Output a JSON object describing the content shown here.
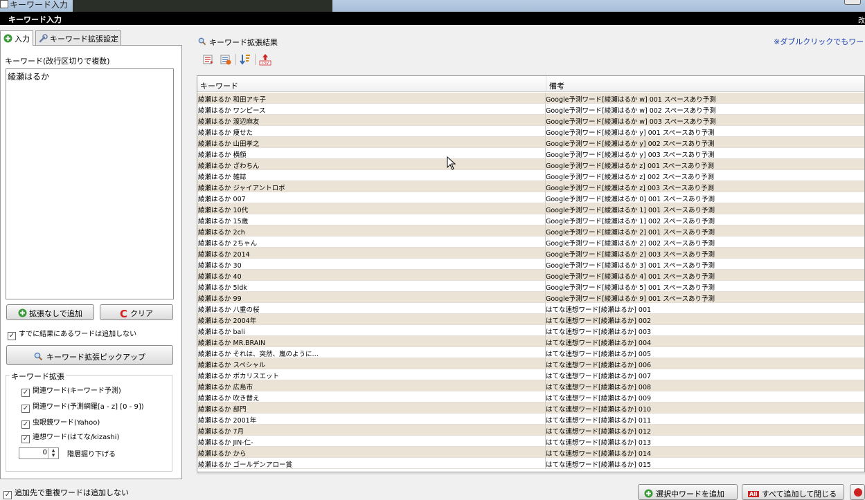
{
  "outer_window": {
    "title": "キーワード入力"
  },
  "window": {
    "title": "キーワード入力",
    "right_fragment": "改"
  },
  "tabs": [
    {
      "label": "入力",
      "icon": "plus-circle-icon",
      "active": true
    },
    {
      "label": "キーワード拡張設定",
      "icon": "wrench-icon",
      "active": false
    }
  ],
  "input_panel": {
    "keyword_label": "キーワード(改行区切りで複数)",
    "keyword_value": "綾瀬はるか",
    "add_no_expand_label": "拡張なしで追加",
    "clear_label": "クリア",
    "skip_existing_label": "すでに結果にあるワードは追加しない",
    "skip_existing_checked": true,
    "pickup_label": "キーワード拡張ピックアップ",
    "expand_group_title": "キーワード拡張",
    "options": [
      {
        "label": "関連ワード(キーワード予測)",
        "checked": true
      },
      {
        "label": "関連ワード(予測網羅[a - z] [0 - 9])",
        "checked": true
      },
      {
        "label": "虫眼鏡ワード(Yahoo)",
        "checked": true
      },
      {
        "label": "連想ワード(はてな/kizashi)",
        "checked": true
      }
    ],
    "depth_value": "0",
    "depth_label": "階層掘り下げる"
  },
  "bottom": {
    "no_duplicate_label": "追加先で重複ワードは追加しない",
    "no_duplicate_checked": true,
    "add_selected_label": "選択中ワードを追加",
    "add_all_close_label": "すべて追加して閉じる"
  },
  "results": {
    "title": "キーワード拡張結果",
    "note": "※ダブルクリックでもワード追",
    "columns": [
      "キーワード",
      "備考"
    ],
    "rows": [
      [
        "綾瀬はるか 和田アキ子",
        "Google予測ワード[綾瀬はるか w] 001 スペースあり予測"
      ],
      [
        "綾瀬はるか ワンピース",
        "Google予測ワード[綾瀬はるか w] 002 スペースあり予測"
      ],
      [
        "綾瀬はるか 渡辺麻友",
        "Google予測ワード[綾瀬はるか w] 003 スペースあり予測"
      ],
      [
        "綾瀬はるか 痩せた",
        "Google予測ワード[綾瀬はるか y] 001 スペースあり予測"
      ],
      [
        "綾瀬はるか 山田孝之",
        "Google予測ワード[綾瀬はるか y] 002 スペースあり予測"
      ],
      [
        "綾瀬はるか 横顔",
        "Google予測ワード[綾瀬はるか y] 003 スペースあり予測"
      ],
      [
        "綾瀬はるか ざわちん",
        "Google予測ワード[綾瀬はるか z] 001 スペースあり予測"
      ],
      [
        "綾瀬はるか 雑誌",
        "Google予測ワード[綾瀬はるか z] 002 スペースあり予測"
      ],
      [
        "綾瀬はるか ジャイアントロボ",
        "Google予測ワード[綾瀬はるか z] 003 スペースあり予測"
      ],
      [
        "綾瀬はるか 007",
        "Google予測ワード[綾瀬はるか 0] 001 スペースあり予測"
      ],
      [
        "綾瀬はるか 10代",
        "Google予測ワード[綾瀬はるか 1] 001 スペースあり予測"
      ],
      [
        "綾瀬はるか 15歳",
        "Google予測ワード[綾瀬はるか 1] 002 スペースあり予測"
      ],
      [
        "綾瀬はるか 2ch",
        "Google予測ワード[綾瀬はるか 2] 001 スペースあり予測"
      ],
      [
        "綾瀬はるか 2ちゃん",
        "Google予測ワード[綾瀬はるか 2] 002 スペースあり予測"
      ],
      [
        "綾瀬はるか 2014",
        "Google予測ワード[綾瀬はるか 2] 003 スペースあり予測"
      ],
      [
        "綾瀬はるか 30",
        "Google予測ワード[綾瀬はるか 3] 001 スペースあり予測"
      ],
      [
        "綾瀬はるか 40",
        "Google予測ワード[綾瀬はるか 4] 001 スペースあり予測"
      ],
      [
        "綾瀬はるか 5ldk",
        "Google予測ワード[綾瀬はるか 5] 001 スペースあり予測"
      ],
      [
        "綾瀬はるか 99",
        "Google予測ワード[綾瀬はるか 9] 001 スペースあり予測"
      ],
      [
        "綾瀬はるか 八重の桜",
        "はてな連想ワード[綾瀬はるか] 001"
      ],
      [
        "綾瀬はるか 2004年",
        "はてな連想ワード[綾瀬はるか] 002"
      ],
      [
        "綾瀬はるか bali",
        "はてな連想ワード[綾瀬はるか] 003"
      ],
      [
        "綾瀬はるか MR.BRAIN",
        "はてな連想ワード[綾瀬はるか] 004"
      ],
      [
        "綾瀬はるか それは、突然、嵐のように…",
        "はてな連想ワード[綾瀬はるか] 005"
      ],
      [
        "綾瀬はるか スペシャル",
        "はてな連想ワード[綾瀬はるか] 006"
      ],
      [
        "綾瀬はるか ポカリスエット",
        "はてな連想ワード[綾瀬はるか] 007"
      ],
      [
        "綾瀬はるか 広島市",
        "はてな連想ワード[綾瀬はるか] 008"
      ],
      [
        "綾瀬はるか 吹き替え",
        "はてな連想ワード[綾瀬はるか] 009"
      ],
      [
        "綾瀬はるか 部門",
        "はてな連想ワード[綾瀬はるか] 010"
      ],
      [
        "綾瀬はるか 2001年",
        "はてな連想ワード[綾瀬はるか] 011"
      ],
      [
        "綾瀬はるか 7月",
        "はてな連想ワード[綾瀬はるか] 012"
      ],
      [
        "綾瀬はるか JIN-仁-",
        "はてな連想ワード[綾瀬はるか] 013"
      ],
      [
        "綾瀬はるか から",
        "はてな連想ワード[綾瀬はるか] 014"
      ],
      [
        "綾瀬はるか ゴールデンアロー賞",
        "はてな連想ワード[綾瀬はるか] 015"
      ]
    ]
  },
  "colors": {
    "row_alt": "#ebe3d5",
    "note_link": "#1a3fb0",
    "clear_red": "#d42020"
  }
}
